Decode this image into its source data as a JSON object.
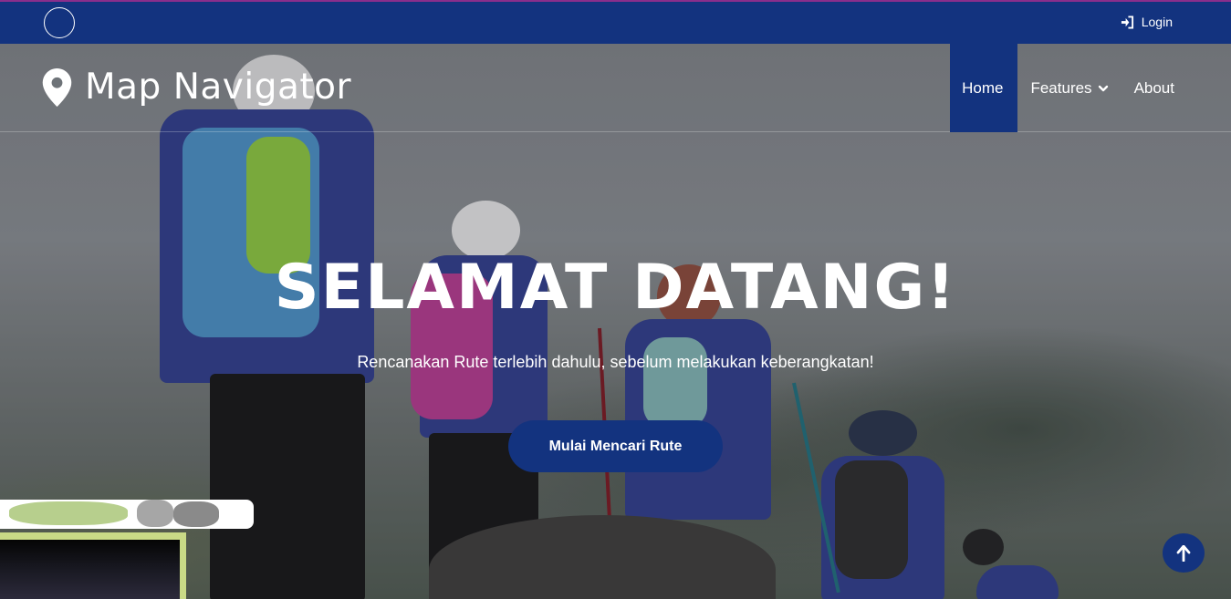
{
  "topbar": {
    "login_label": "Login"
  },
  "navbar": {
    "brand": "Map Navigator",
    "menu": [
      {
        "label": "Home",
        "active": true
      },
      {
        "label": "Features",
        "has_dropdown": true
      },
      {
        "label": "About"
      }
    ]
  },
  "hero": {
    "title": "SELAMAT DATANG!",
    "subtitle": "Rencanakan Rute terlebih dahulu, sebelum melakukan keberangkatan!",
    "cta_label": "Mulai Mencari Rute"
  },
  "icons": {
    "login": "sign-in-icon",
    "brand": "map-marker-icon",
    "dropdown": "chevron-down-icon",
    "scroll_top": "arrow-up-icon"
  },
  "colors": {
    "primary": "#13337f",
    "text": "#ffffff",
    "accent_line": "#8a2e8c"
  }
}
